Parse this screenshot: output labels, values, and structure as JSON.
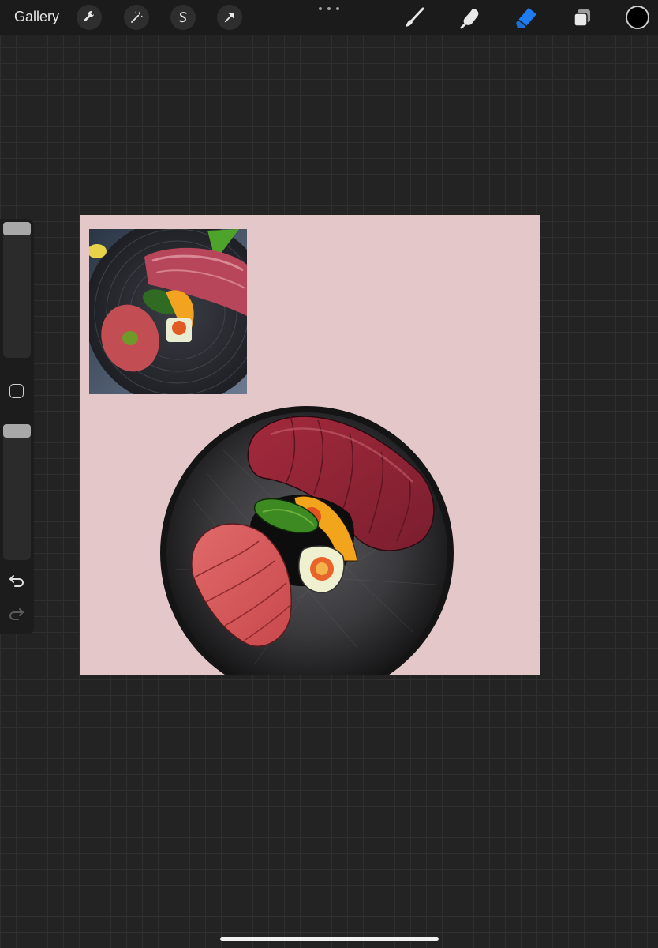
{
  "app": {
    "gallery_label": "Gallery"
  },
  "toolbar": {
    "left_tools": [
      {
        "icon": "wrench-icon",
        "name": "actions"
      },
      {
        "icon": "magic-wand-icon",
        "name": "adjustments"
      },
      {
        "icon": "selection-s-icon",
        "name": "selection"
      },
      {
        "icon": "cursor-arrow-icon",
        "name": "transform"
      }
    ],
    "right_tools": [
      {
        "icon": "brush-icon",
        "name": "brush",
        "active": false
      },
      {
        "icon": "smudge-icon",
        "name": "smudge",
        "active": false
      },
      {
        "icon": "eraser-icon",
        "name": "eraser",
        "active": true
      },
      {
        "icon": "layers-icon",
        "name": "layers",
        "active": false
      }
    ],
    "current_color": "#000000",
    "active_tool_color": "#1e7bf0"
  },
  "sidebar": {
    "brush_size_level": 0.0,
    "opacity_level": 0.0
  },
  "canvas": {
    "background_color": "#e4c8c9"
  }
}
